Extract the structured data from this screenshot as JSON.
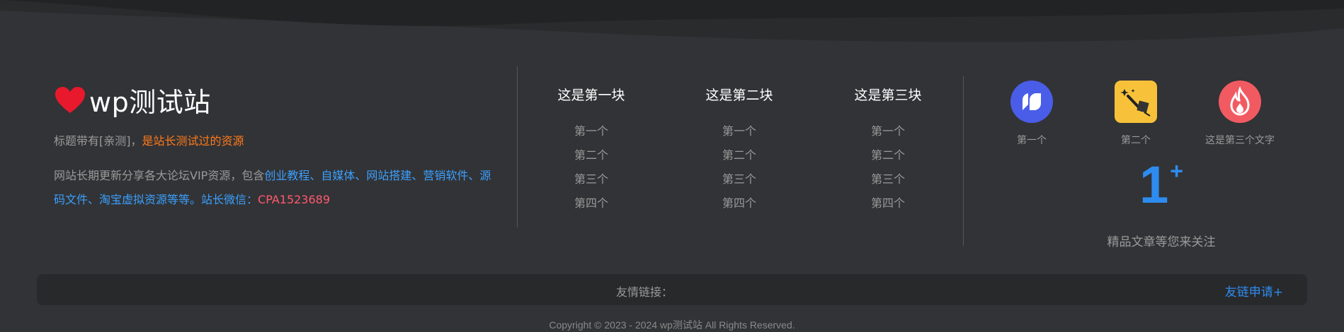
{
  "brand": {
    "site_name": "wp测试站",
    "icon": "heart-icon",
    "tagline_prefix": "标题带有[亲测]，",
    "tagline_highlight": "是站长测试过的资源",
    "desc_prefix": "网站长期更新分享各大论坛VIP资源，包含",
    "desc_links": "创业教程、自媒体、网站搭建、营销软件、源码文件、淘宝虚拟资源等等。站长微信：",
    "desc_wechat": "CPA1523689"
  },
  "menus": [
    {
      "title": "这是第一块",
      "items": [
        "第一个",
        "第二个",
        "第三个",
        "第四个"
      ]
    },
    {
      "title": "这是第二块",
      "items": [
        "第一个",
        "第二个",
        "第三个",
        "第四个"
      ]
    },
    {
      "title": "这是第三块",
      "items": [
        "第一个",
        "第二个",
        "第三个",
        "第四个"
      ]
    }
  ],
  "apps": [
    {
      "label": "第一个",
      "icon": "blue-app-icon",
      "color": "#4a5de8"
    },
    {
      "label": "第二个",
      "icon": "magic-wand-icon",
      "color": "#f7c23a"
    },
    {
      "label": "这是第三个文字",
      "icon": "flame-icon",
      "color": "#f25a62"
    }
  ],
  "counter": {
    "number": "1",
    "suffix": "+",
    "label": "精品文章等您来关注"
  },
  "links": {
    "label": "友情链接：",
    "apply": "友链申请+"
  },
  "copyright": "Copyright © 2023 - 2024 wp测试站 All Rights Reserved.",
  "colors": {
    "background": "#323336",
    "accent_blue": "#2e8cf0",
    "highlight_orange": "#ff7a1a",
    "highlight_red": "#ff5a6e"
  }
}
